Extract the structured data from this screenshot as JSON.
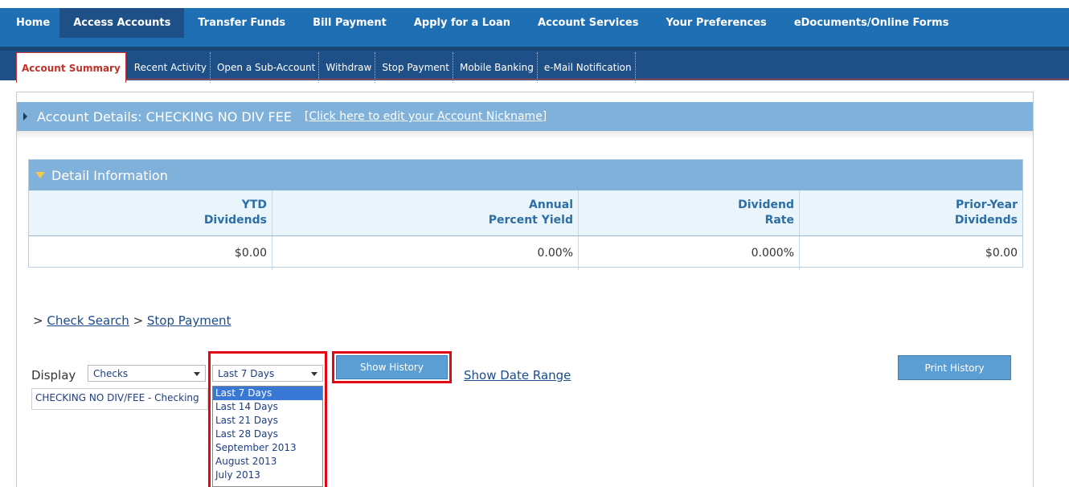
{
  "top_tabs": [
    {
      "label": "Home",
      "active": false
    },
    {
      "label": "Access Accounts",
      "active": true
    },
    {
      "label": "Transfer Funds",
      "active": false
    },
    {
      "label": "Bill Payment",
      "active": false
    },
    {
      "label": "Apply for a Loan",
      "active": false
    },
    {
      "label": "Account Services",
      "active": false
    },
    {
      "label": "Your Preferences",
      "active": false
    },
    {
      "label": "eDocuments/Online Forms",
      "active": false
    }
  ],
  "sub_tabs": [
    {
      "label": "Account Summary",
      "active": true
    },
    {
      "label": "Recent Activity",
      "active": false
    },
    {
      "label": "Open a Sub-Account",
      "active": false
    },
    {
      "label": "Withdraw",
      "active": false
    },
    {
      "label": "Stop Payment",
      "active": false
    },
    {
      "label": "Mobile Banking",
      "active": false
    },
    {
      "label": "e-Mail Notification",
      "active": false
    }
  ],
  "account": {
    "title": "Account Details: CHECKING NO DIV FEE",
    "edit_link": "[Click here to edit your Account Nickname]"
  },
  "detail": {
    "header": "Detail Information",
    "columns": [
      {
        "line1": "YTD",
        "line2": "Dividends"
      },
      {
        "line1": "Annual",
        "line2": "Percent Yield"
      },
      {
        "line1": "Dividend",
        "line2": "Rate"
      },
      {
        "line1": "Prior-Year",
        "line2": "Dividends"
      }
    ],
    "values": [
      "$0.00",
      "0.00%",
      "0.000%",
      "$0.00"
    ]
  },
  "breadcrumb": {
    "prefix1": "> ",
    "link1": "Check Search",
    "prefix2": " > ",
    "link2": "Stop Payment"
  },
  "history": {
    "display_label": "Display",
    "type_value": "Checks",
    "period_value": "Last 7 Days",
    "show_history": "Show History",
    "show_date_range": "Show Date Range",
    "print_history": "Print History",
    "account_option": "CHECKING NO DIV/FEE - Checking",
    "period_options": [
      "Last 7 Days",
      "Last 14 Days",
      "Last 21 Days",
      "Last 28 Days",
      "September 2013",
      "August 2013",
      "July 2013"
    ]
  },
  "colors": {
    "nav_blue": "#1f6fb5",
    "subnav_blue": "#1e4f86",
    "header_blue": "#7fb1da",
    "highlight_red": "#e30613"
  }
}
